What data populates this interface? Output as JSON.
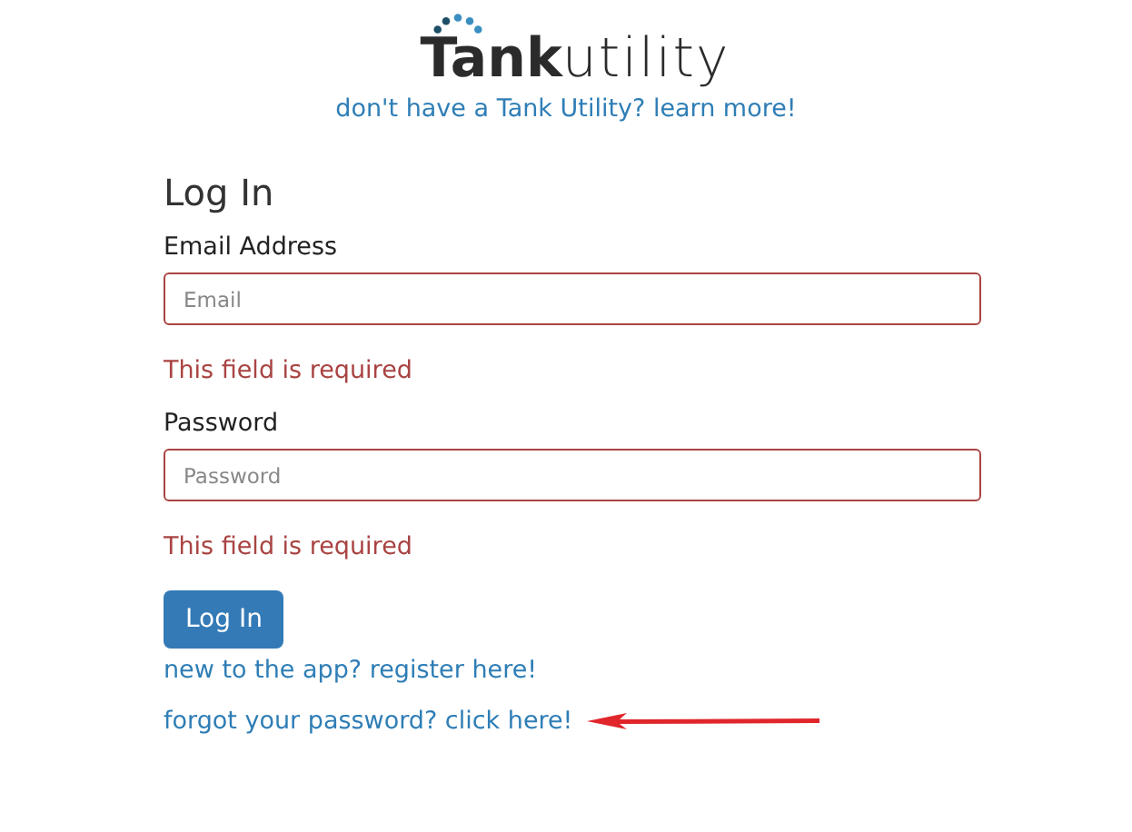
{
  "logo": {
    "text": "**Tank**utility"
  },
  "promo_link": "don't have a Tank Utility? learn more!",
  "form": {
    "title": "Log In",
    "fields": [
      {
        "label": "Email Address",
        "placeholder": "Email",
        "invalid": true,
        "error": "This field is required"
      },
      {
        "label": "Password",
        "placeholder": "Password",
        "invalid": true,
        "error": "This field is required"
      }
    ],
    "submit": "Log In",
    "links": [
      {
        "text": "new to the app? register here!",
        "annotated": false
      },
      {
        "text": "forgot your password? click here!",
        "annotated": true
      }
    ]
  }
}
